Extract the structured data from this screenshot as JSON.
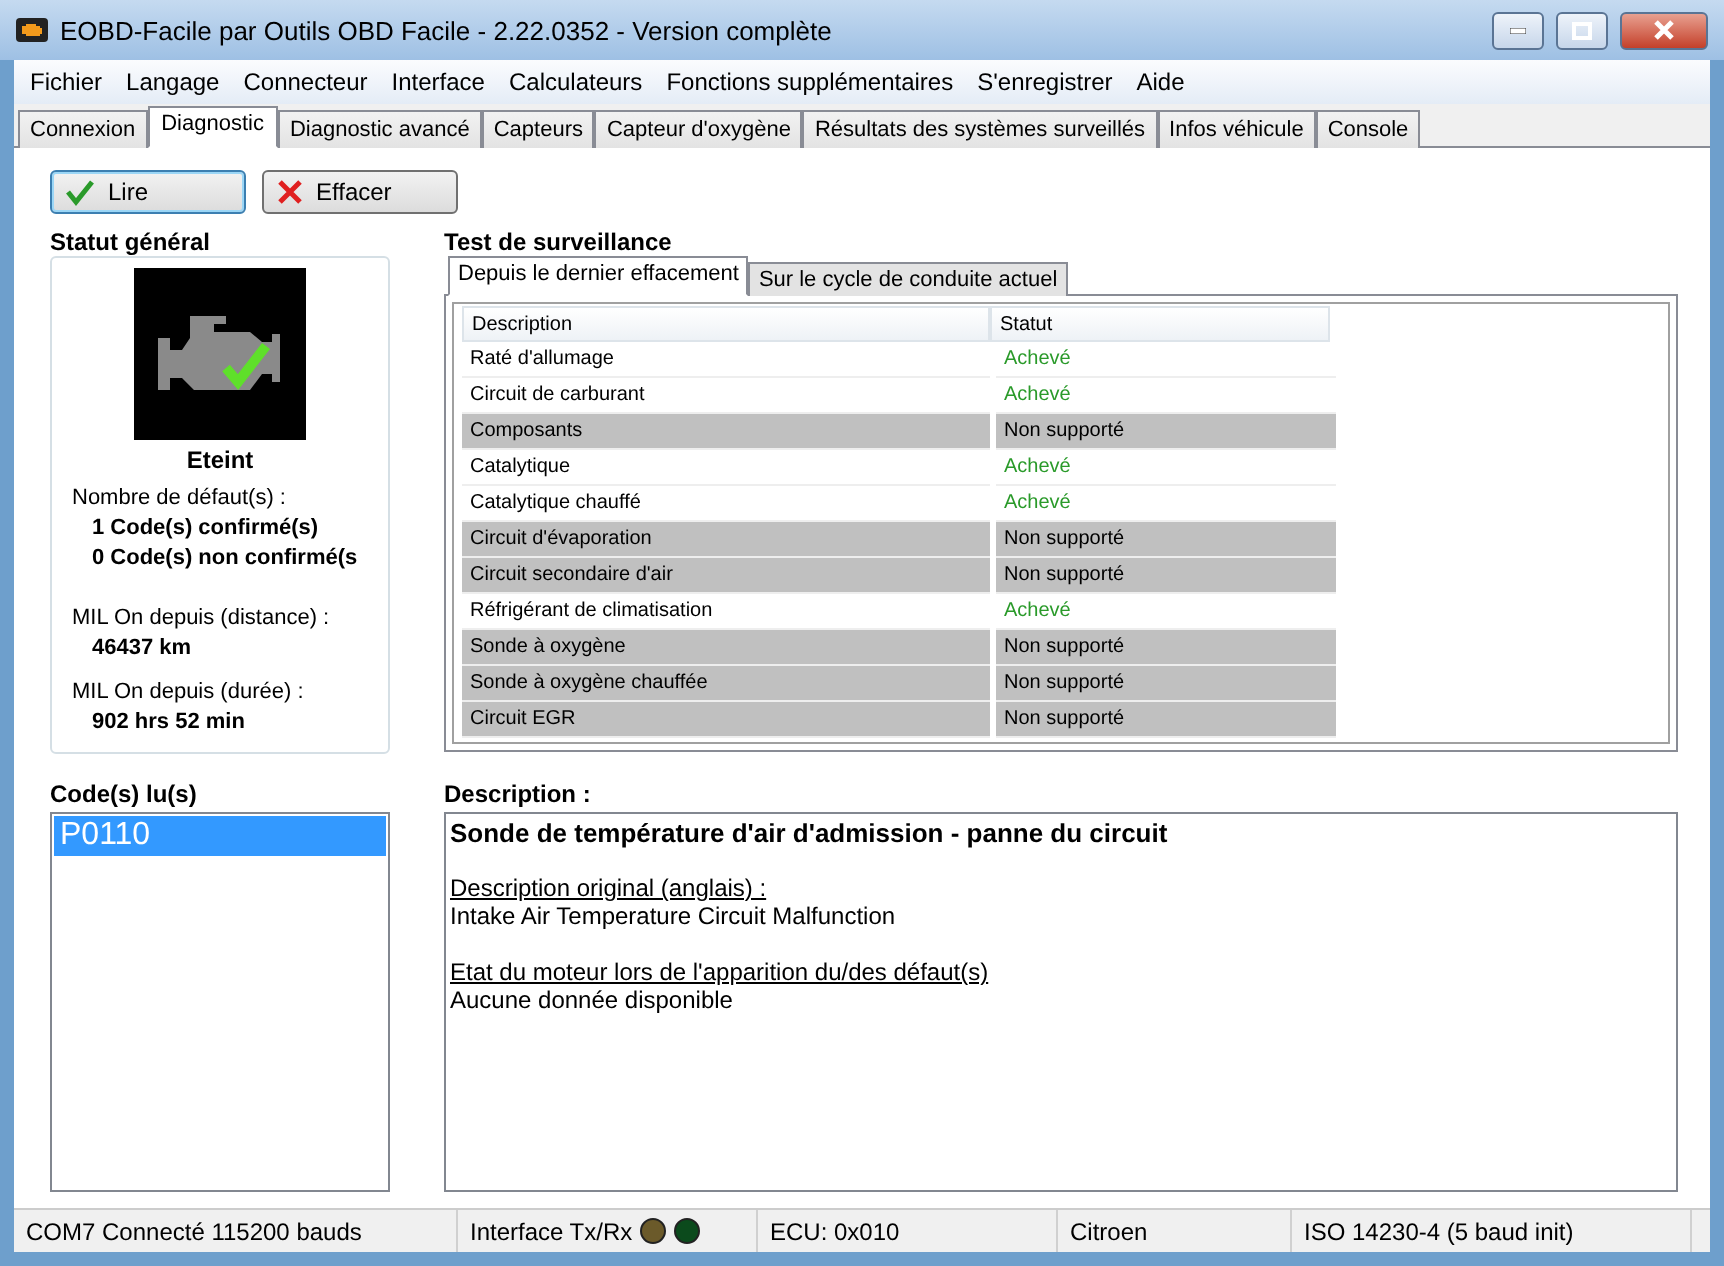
{
  "window": {
    "title": "EOBD-Facile par Outils OBD Facile - 2.22.0352 - Version complète"
  },
  "menu": [
    "Fichier",
    "Langage",
    "Connecteur",
    "Interface",
    "Calculateurs",
    "Fonctions supplémentaires",
    "S'enregistrer",
    "Aide"
  ],
  "tabs": [
    {
      "label": "Connexion",
      "selected": false
    },
    {
      "label": "Diagnostic",
      "selected": true
    },
    {
      "label": "Diagnostic avancé",
      "selected": false
    },
    {
      "label": "Capteurs",
      "selected": false
    },
    {
      "label": "Capteur d'oxygène",
      "selected": false
    },
    {
      "label": "Résultats des systèmes surveillés",
      "selected": false
    },
    {
      "label": "Infos véhicule",
      "selected": false
    },
    {
      "label": "Console",
      "selected": false
    }
  ],
  "buttons": [
    {
      "label": "Lire",
      "kind": "read"
    },
    {
      "label": "Effacer",
      "kind": "clear"
    }
  ],
  "general_status": {
    "title": "Statut général",
    "mil_state": "Eteint",
    "faults_label": "Nombre de défaut(s) :",
    "confirmed": "1 Code(s) confirmé(s)",
    "unconfirmed": "0 Code(s) non confirmé(s",
    "distance_label": "MIL On depuis (distance) :",
    "distance": "46437 km",
    "duration_label": "MIL On depuis (durée) :",
    "duration": "902 hrs 52 min"
  },
  "monitor": {
    "title": "Test de surveillance",
    "tabs": [
      {
        "label": "Depuis le dernier effacement",
        "selected": true
      },
      {
        "label": "Sur le cycle de conduite actuel",
        "selected": false
      }
    ],
    "columns": [
      "Description",
      "Statut"
    ],
    "rows": [
      {
        "description": "Raté d'allumage",
        "status": "Achevé",
        "supported": true
      },
      {
        "description": "Circuit de carburant",
        "status": "Achevé",
        "supported": true
      },
      {
        "description": "Composants",
        "status": "Non supporté",
        "supported": false
      },
      {
        "description": "Catalytique",
        "status": "Achevé",
        "supported": true
      },
      {
        "description": "Catalytique chauffé",
        "status": "Achevé",
        "supported": true
      },
      {
        "description": "Circuit d'évaporation",
        "status": "Non supporté",
        "supported": false
      },
      {
        "description": "Circuit secondaire d'air",
        "status": "Non supporté",
        "supported": false
      },
      {
        "description": "Réfrigérant de climatisation",
        "status": "Achevé",
        "supported": true
      },
      {
        "description": "Sonde à oxygène",
        "status": "Non supporté",
        "supported": false
      },
      {
        "description": "Sonde à oxygène chauffée",
        "status": "Non supporté",
        "supported": false
      },
      {
        "description": "Circuit EGR",
        "status": "Non supporté",
        "supported": false
      }
    ]
  },
  "codes": {
    "title": "Code(s) lu(s)",
    "items": [
      {
        "code": "P0110",
        "selected": true
      }
    ]
  },
  "description": {
    "title": "Description :",
    "heading": "Sonde de température d'air d'admission - panne du circuit",
    "original_label": "Description original (anglais) :",
    "original": "Intake Air Temperature Circuit Malfunction",
    "state_label": "Etat du moteur lors de l'apparition du/des défaut(s)",
    "state": "Aucune donnée disponible"
  },
  "status_bar": {
    "port": "COM7 Connecté 115200 bauds",
    "interface": "Interface Tx/Rx",
    "leds": [
      {
        "color": "#6b5a2a"
      },
      {
        "color": "#0b4a1c"
      }
    ],
    "ecu": "ECU: 0x010",
    "make": "Citroen",
    "protocol": "ISO 14230-4 (5 baud init)"
  }
}
